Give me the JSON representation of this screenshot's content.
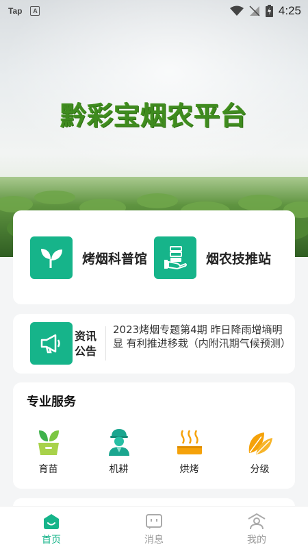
{
  "status_bar": {
    "app_label": "Tap",
    "time": "4:25"
  },
  "hero": {
    "title": "黔彩宝烟农平台"
  },
  "features": [
    {
      "label": "烤烟科普馆",
      "icon": "sprout-icon"
    },
    {
      "label": "烟农技推站",
      "icon": "hand-server-icon"
    }
  ],
  "notice": {
    "label": "资讯公告",
    "text": "2023烤烟专题第4期 昨日降雨增墒明显 有利推进移栽（内附汛期气候预测）",
    "icon": "megaphone-icon"
  },
  "services": {
    "title": "专业服务",
    "items": [
      {
        "label": "育苗",
        "icon": "seedling-pot-icon"
      },
      {
        "label": "机耕",
        "icon": "worker-icon"
      },
      {
        "label": "烘烤",
        "icon": "heater-icon"
      },
      {
        "label": "分级",
        "icon": "leaves-icon"
      }
    ]
  },
  "bottom_nav": [
    {
      "label": "首页",
      "icon": "home-icon",
      "active": true
    },
    {
      "label": "消息",
      "icon": "message-icon",
      "active": false
    },
    {
      "label": "我的",
      "icon": "profile-icon",
      "active": false
    }
  ],
  "colors": {
    "accent": "#16b48a",
    "title_green": "#3f8b1f",
    "orange": "#f5a20a"
  }
}
